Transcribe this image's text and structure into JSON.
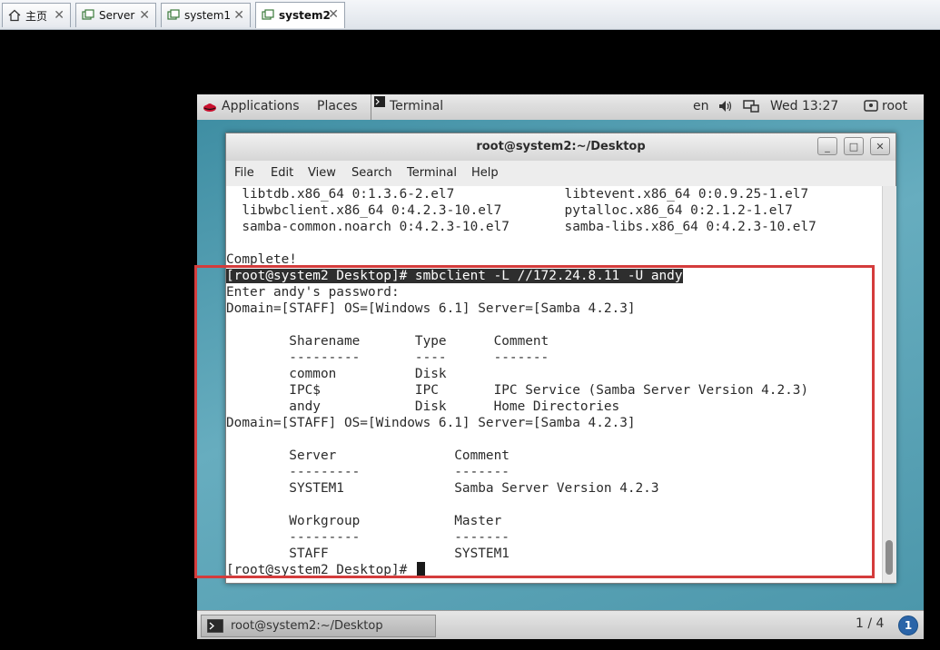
{
  "tabs": [
    {
      "label": "主页",
      "icon": "home-icon"
    },
    {
      "label": "Server",
      "icon": "vm-icon"
    },
    {
      "label": "system1",
      "icon": "vm-icon"
    },
    {
      "label": "system2",
      "icon": "vm-icon",
      "active": true
    }
  ],
  "topbar": {
    "applications": "Applications",
    "places": "Places",
    "window_title": "Terminal",
    "lang": "en",
    "clock": "Wed 13:27",
    "user": "root"
  },
  "window": {
    "title": "root@system2:~/Desktop",
    "menu": [
      "File",
      "Edit",
      "View",
      "Search",
      "Terminal",
      "Help"
    ]
  },
  "terminal": {
    "lines": [
      "  libtdb.x86_64 0:1.3.6-2.el7              libtevent.x86_64 0:0.9.25-1.el7",
      "  libwbclient.x86_64 0:4.2.3-10.el7        pytalloc.x86_64 0:2.1.2-1.el7",
      "  samba-common.noarch 0:4.2.3-10.el7       samba-libs.x86_64 0:4.2.3-10.el7",
      "",
      "Complete!",
      "[root@system2 Desktop]# smbclient -L //172.24.8.11 -U andy",
      "Enter andy's password:",
      "Domain=[STAFF] OS=[Windows 6.1] Server=[Samba 4.2.3]",
      "",
      "        Sharename       Type      Comment",
      "        ---------       ----      -------",
      "        common          Disk",
      "        IPC$            IPC       IPC Service (Samba Server Version 4.2.3)",
      "        andy            Disk      Home Directories",
      "Domain=[STAFF] OS=[Windows 6.1] Server=[Samba 4.2.3]",
      "",
      "        Server               Comment",
      "        ---------            -------",
      "        SYSTEM1              Samba Server Version 4.2.3",
      "",
      "        Workgroup            Master",
      "        ---------            -------",
      "        STAFF                SYSTEM1",
      "[root@system2 Desktop]# "
    ]
  },
  "taskbar": {
    "task_label": "root@system2:~/Desktop",
    "workspace": "1 / 4",
    "notification_count": "1"
  }
}
